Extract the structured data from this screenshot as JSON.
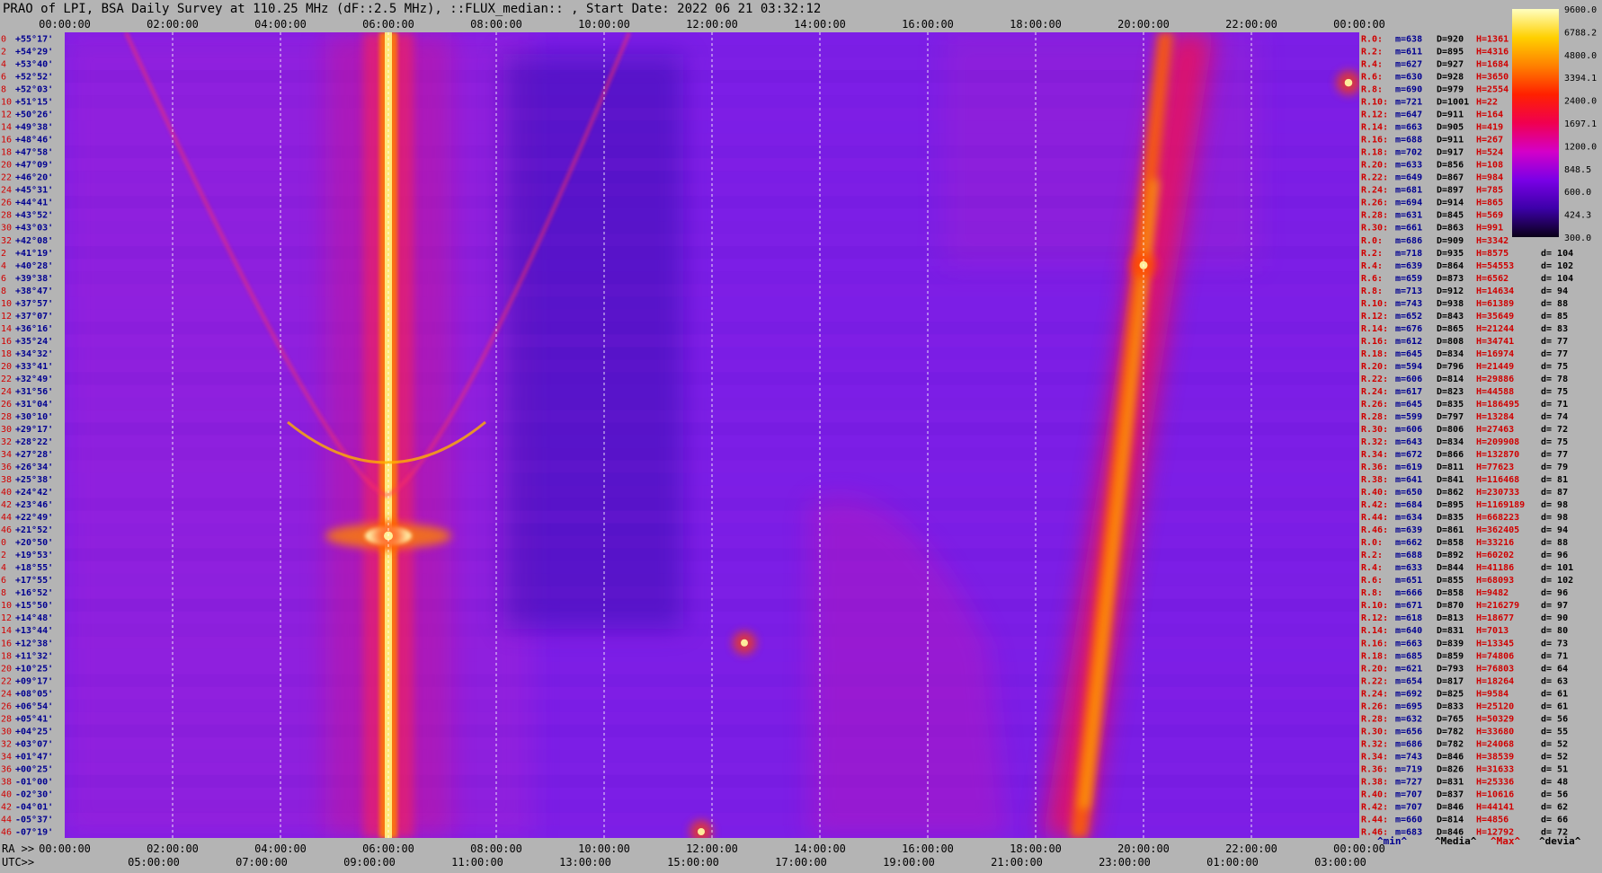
{
  "header": {
    "title": "PRAO of LPI, BSA Daily Survey at 110.25 MHz (dF::2.5 MHz), ::FLUX_median:: , Start Date: 2022 06 21 03:32:12"
  },
  "chart_data": {
    "type": "heatmap",
    "title": "PRAO of LPI, BSA Daily Survey at 110.25 MHz (dF::2.5 MHz), ::FLUX_median:: , Start Date: 2022 06 21 03:32:12",
    "x_top_ticks": [
      "00:00:00",
      "02:00:00",
      "04:00:00",
      "06:00:00",
      "08:00:00",
      "10:00:00",
      "12:00:00",
      "14:00:00",
      "16:00:00",
      "18:00:00",
      "20:00:00",
      "22:00:00",
      "00:00:00"
    ],
    "x_bottom_ra_prefix": "RA >>",
    "x_bottom_ra_ticks": [
      "00:00:00",
      "02:00:00",
      "04:00:00",
      "06:00:00",
      "08:00:00",
      "10:00:00",
      "12:00:00",
      "14:00:00",
      "16:00:00",
      "18:00:00",
      "20:00:00",
      "22:00:00",
      "00:00:00"
    ],
    "x_bottom_utc_prefix": "UTC>>",
    "x_bottom_utc_ticks": [
      "05:00:00",
      "07:00:00",
      "09:00:00",
      "11:00:00",
      "13:00:00",
      "15:00:00",
      "17:00:00",
      "19:00:00",
      "21:00:00",
      "23:00:00",
      "01:00:00",
      "03:00:00"
    ],
    "y_rows": [
      {
        "idx": "0",
        "dec": "+55°17'"
      },
      {
        "idx": "2",
        "dec": "+54°29'"
      },
      {
        "idx": "4",
        "dec": "+53°40'"
      },
      {
        "idx": "6",
        "dec": "+52°52'"
      },
      {
        "idx": "8",
        "dec": "+52°03'"
      },
      {
        "idx": "10",
        "dec": "+51°15'"
      },
      {
        "idx": "12",
        "dec": "+50°26'"
      },
      {
        "idx": "14",
        "dec": "+49°38'"
      },
      {
        "idx": "16",
        "dec": "+48°46'"
      },
      {
        "idx": "18",
        "dec": "+47°58'"
      },
      {
        "idx": "20",
        "dec": "+47°09'"
      },
      {
        "idx": "22",
        "dec": "+46°20'"
      },
      {
        "idx": "24",
        "dec": "+45°31'"
      },
      {
        "idx": "26",
        "dec": "+44°41'"
      },
      {
        "idx": "28",
        "dec": "+43°52'"
      },
      {
        "idx": "30",
        "dec": "+43°03'"
      },
      {
        "idx": "32",
        "dec": "+42°08'"
      },
      {
        "idx": "2",
        "dec": "+41°19'"
      },
      {
        "idx": "4",
        "dec": "+40°28'"
      },
      {
        "idx": "6",
        "dec": "+39°38'"
      },
      {
        "idx": "8",
        "dec": "+38°47'"
      },
      {
        "idx": "10",
        "dec": "+37°57'"
      },
      {
        "idx": "12",
        "dec": "+37°07'"
      },
      {
        "idx": "14",
        "dec": "+36°16'"
      },
      {
        "idx": "16",
        "dec": "+35°24'"
      },
      {
        "idx": "18",
        "dec": "+34°32'"
      },
      {
        "idx": "20",
        "dec": "+33°41'"
      },
      {
        "idx": "22",
        "dec": "+32°49'"
      },
      {
        "idx": "24",
        "dec": "+31°56'"
      },
      {
        "idx": "26",
        "dec": "+31°04'"
      },
      {
        "idx": "28",
        "dec": "+30°10'"
      },
      {
        "idx": "30",
        "dec": "+29°17'"
      },
      {
        "idx": "32",
        "dec": "+28°22'"
      },
      {
        "idx": "34",
        "dec": "+27°28'"
      },
      {
        "idx": "36",
        "dec": "+26°34'"
      },
      {
        "idx": "38",
        "dec": "+25°38'"
      },
      {
        "idx": "40",
        "dec": "+24°42'"
      },
      {
        "idx": "42",
        "dec": "+23°46'"
      },
      {
        "idx": "44",
        "dec": "+22°49'"
      },
      {
        "idx": "46",
        "dec": "+21°52'"
      },
      {
        "idx": "0",
        "dec": "+20°50'"
      },
      {
        "idx": "2",
        "dec": "+19°53'"
      },
      {
        "idx": "4",
        "dec": "+18°55'"
      },
      {
        "idx": "6",
        "dec": "+17°55'"
      },
      {
        "idx": "8",
        "dec": "+16°52'"
      },
      {
        "idx": "10",
        "dec": "+15°50'"
      },
      {
        "idx": "12",
        "dec": "+14°48'"
      },
      {
        "idx": "14",
        "dec": "+13°44'"
      },
      {
        "idx": "16",
        "dec": "+12°38'"
      },
      {
        "idx": "18",
        "dec": "+11°32'"
      },
      {
        "idx": "20",
        "dec": "+10°25'"
      },
      {
        "idx": "22",
        "dec": "+09°17'"
      },
      {
        "idx": "24",
        "dec": "+08°05'"
      },
      {
        "idx": "26",
        "dec": "+06°54'"
      },
      {
        "idx": "28",
        "dec": "+05°41'"
      },
      {
        "idx": "30",
        "dec": "+04°25'"
      },
      {
        "idx": "32",
        "dec": "+03°07'"
      },
      {
        "idx": "34",
        "dec": "+01°47'"
      },
      {
        "idx": "36",
        "dec": "+00°25'"
      },
      {
        "idx": "38",
        "dec": "-01°00'"
      },
      {
        "idx": "40",
        "dec": "-02°30'"
      },
      {
        "idx": "42",
        "dec": "-04°01'"
      },
      {
        "idx": "44",
        "dec": "-05°37'"
      },
      {
        "idx": "46",
        "dec": "-07°19'"
      }
    ],
    "stats": [
      {
        "r": "R.0:",
        "m": "m=638",
        "d": "D=920",
        "h": "H=1361",
        "dev": ""
      },
      {
        "r": "R.2:",
        "m": "m=611",
        "d": "D=895",
        "h": "H=4316",
        "dev": ""
      },
      {
        "r": "R.4:",
        "m": "m=627",
        "d": "D=927",
        "h": "H=1684",
        "dev": ""
      },
      {
        "r": "R.6:",
        "m": "m=630",
        "d": "D=928",
        "h": "H=3650",
        "dev": ""
      },
      {
        "r": "R.8:",
        "m": "m=690",
        "d": "D=979",
        "h": "H=2554",
        "dev": ""
      },
      {
        "r": "R.10:",
        "m": "m=721",
        "d": "D=1001",
        "h": "H=22",
        "dev": ""
      },
      {
        "r": "R.12:",
        "m": "m=647",
        "d": "D=911",
        "h": "H=164",
        "dev": ""
      },
      {
        "r": "R.14:",
        "m": "m=663",
        "d": "D=905",
        "h": "H=419",
        "dev": ""
      },
      {
        "r": "R.16:",
        "m": "m=688",
        "d": "D=911",
        "h": "H=267",
        "dev": ""
      },
      {
        "r": "R.18:",
        "m": "m=702",
        "d": "D=917",
        "h": "H=524",
        "dev": ""
      },
      {
        "r": "R.20:",
        "m": "m=633",
        "d": "D=856",
        "h": "H=108",
        "dev": ""
      },
      {
        "r": "R.22:",
        "m": "m=649",
        "d": "D=867",
        "h": "H=984",
        "dev": ""
      },
      {
        "r": "R.24:",
        "m": "m=681",
        "d": "D=897",
        "h": "H=785",
        "dev": ""
      },
      {
        "r": "R.26:",
        "m": "m=694",
        "d": "D=914",
        "h": "H=865",
        "dev": ""
      },
      {
        "r": "R.28:",
        "m": "m=631",
        "d": "D=845",
        "h": "H=569",
        "dev": ""
      },
      {
        "r": "R.30:",
        "m": "m=661",
        "d": "D=863",
        "h": "H=991",
        "dev": ""
      },
      {
        "r": "R.0:",
        "m": "m=686",
        "d": "D=909",
        "h": "H=3342",
        "dev": ""
      },
      {
        "r": "R.2:",
        "m": "m=718",
        "d": "D=935",
        "h": "H=8575",
        "dev": "d= 104"
      },
      {
        "r": "R.4:",
        "m": "m=639",
        "d": "D=864",
        "h": "H=54553",
        "dev": "d= 102"
      },
      {
        "r": "R.6:",
        "m": "m=659",
        "d": "D=873",
        "h": "H=6562",
        "dev": "d= 104"
      },
      {
        "r": "R.8:",
        "m": "m=713",
        "d": "D=912",
        "h": "H=14634",
        "dev": "d= 94"
      },
      {
        "r": "R.10:",
        "m": "m=743",
        "d": "D=938",
        "h": "H=61389",
        "dev": "d= 88"
      },
      {
        "r": "R.12:",
        "m": "m=652",
        "d": "D=843",
        "h": "H=35649",
        "dev": "d= 85"
      },
      {
        "r": "R.14:",
        "m": "m=676",
        "d": "D=865",
        "h": "H=21244",
        "dev": "d= 83"
      },
      {
        "r": "R.16:",
        "m": "m=612",
        "d": "D=808",
        "h": "H=34741",
        "dev": "d= 77"
      },
      {
        "r": "R.18:",
        "m": "m=645",
        "d": "D=834",
        "h": "H=16974",
        "dev": "d= 77"
      },
      {
        "r": "R.20:",
        "m": "m=594",
        "d": "D=796",
        "h": "H=21449",
        "dev": "d= 75"
      },
      {
        "r": "R.22:",
        "m": "m=606",
        "d": "D=814",
        "h": "H=29886",
        "dev": "d= 78"
      },
      {
        "r": "R.24:",
        "m": "m=617",
        "d": "D=823",
        "h": "H=44588",
        "dev": "d= 75"
      },
      {
        "r": "R.26:",
        "m": "m=645",
        "d": "D=835",
        "h": "H=186495",
        "dev": "d= 71"
      },
      {
        "r": "R.28:",
        "m": "m=599",
        "d": "D=797",
        "h": "H=13284",
        "dev": "d= 74"
      },
      {
        "r": "R.30:",
        "m": "m=606",
        "d": "D=806",
        "h": "H=27463",
        "dev": "d= 72"
      },
      {
        "r": "R.32:",
        "m": "m=643",
        "d": "D=834",
        "h": "H=209908",
        "dev": "d= 75"
      },
      {
        "r": "R.34:",
        "m": "m=672",
        "d": "D=866",
        "h": "H=132870",
        "dev": "d= 77"
      },
      {
        "r": "R.36:",
        "m": "m=619",
        "d": "D=811",
        "h": "H=77623",
        "dev": "d= 79"
      },
      {
        "r": "R.38:",
        "m": "m=641",
        "d": "D=841",
        "h": "H=116468",
        "dev": "d= 81"
      },
      {
        "r": "R.40:",
        "m": "m=650",
        "d": "D=862",
        "h": "H=230733",
        "dev": "d= 87"
      },
      {
        "r": "R.42:",
        "m": "m=684",
        "d": "D=895",
        "h": "H=1169189",
        "dev": "d= 98"
      },
      {
        "r": "R.44:",
        "m": "m=634",
        "d": "D=835",
        "h": "H=668223",
        "dev": "d= 98"
      },
      {
        "r": "R.46:",
        "m": "m=639",
        "d": "D=861",
        "h": "H=362405",
        "dev": "d= 94"
      },
      {
        "r": "R.0:",
        "m": "m=662",
        "d": "D=858",
        "h": "H=33216",
        "dev": "d= 88"
      },
      {
        "r": "R.2:",
        "m": "m=688",
        "d": "D=892",
        "h": "H=60202",
        "dev": "d= 96"
      },
      {
        "r": "R.4:",
        "m": "m=633",
        "d": "D=844",
        "h": "H=41186",
        "dev": "d= 101"
      },
      {
        "r": "R.6:",
        "m": "m=651",
        "d": "D=855",
        "h": "H=68093",
        "dev": "d= 102"
      },
      {
        "r": "R.8:",
        "m": "m=666",
        "d": "D=858",
        "h": "H=9482",
        "dev": "d= 96"
      },
      {
        "r": "R.10:",
        "m": "m=671",
        "d": "D=870",
        "h": "H=216279",
        "dev": "d= 97"
      },
      {
        "r": "R.12:",
        "m": "m=618",
        "d": "D=813",
        "h": "H=18677",
        "dev": "d= 90"
      },
      {
        "r": "R.14:",
        "m": "m=640",
        "d": "D=831",
        "h": "H=7013",
        "dev": "d= 80"
      },
      {
        "r": "R.16:",
        "m": "m=663",
        "d": "D=839",
        "h": "H=13345",
        "dev": "d= 73"
      },
      {
        "r": "R.18:",
        "m": "m=685",
        "d": "D=859",
        "h": "H=74806",
        "dev": "d= 71"
      },
      {
        "r": "R.20:",
        "m": "m=621",
        "d": "D=793",
        "h": "H=76803",
        "dev": "d= 64"
      },
      {
        "r": "R.22:",
        "m": "m=654",
        "d": "D=817",
        "h": "H=18264",
        "dev": "d= 63"
      },
      {
        "r": "R.24:",
        "m": "m=692",
        "d": "D=825",
        "h": "H=9584",
        "dev": "d= 61"
      },
      {
        "r": "R.26:",
        "m": "m=695",
        "d": "D=833",
        "h": "H=25120",
        "dev": "d= 61"
      },
      {
        "r": "R.28:",
        "m": "m=632",
        "d": "D=765",
        "h": "H=50329",
        "dev": "d= 56"
      },
      {
        "r": "R.30:",
        "m": "m=656",
        "d": "D=782",
        "h": "H=33680",
        "dev": "d= 55"
      },
      {
        "r": "R.32:",
        "m": "m=686",
        "d": "D=782",
        "h": "H=24068",
        "dev": "d= 52"
      },
      {
        "r": "R.34:",
        "m": "m=743",
        "d": "D=846",
        "h": "H=38539",
        "dev": "d= 52"
      },
      {
        "r": "R.36:",
        "m": "m=719",
        "d": "D=826",
        "h": "H=31633",
        "dev": "d= 51"
      },
      {
        "r": "R.38:",
        "m": "m=727",
        "d": "D=831",
        "h": "H=25336",
        "dev": "d= 48"
      },
      {
        "r": "R.40:",
        "m": "m=707",
        "d": "D=837",
        "h": "H=10616",
        "dev": "d= 56"
      },
      {
        "r": "R.42:",
        "m": "m=707",
        "d": "D=846",
        "h": "H=44141",
        "dev": "d= 62"
      },
      {
        "r": "R.44:",
        "m": "m=660",
        "d": "D=814",
        "h": "H=4856",
        "dev": "d= 66"
      },
      {
        "r": "R.46:",
        "m": "m=683",
        "d": "D=846",
        "h": "H=12792",
        "dev": "d= 72"
      }
    ],
    "stats_footer": {
      "min": "^min^",
      "media": "^Media^",
      "max": "^Max^",
      "devia": "^devia^"
    },
    "colorbar": {
      "labels": [
        "9600.0",
        "6788.2",
        "4800.0",
        "3394.1",
        "2400.0",
        "1697.1",
        "1200.0",
        "848.5",
        "600.0",
        "424.3",
        "300.0"
      ],
      "scale": "log",
      "range": [
        300,
        9600
      ],
      "colors": [
        "#0a0018",
        "#3c00a8",
        "#7a00e6",
        "#d400c8",
        "#f00050",
        "#ff2000",
        "#ff8000",
        "#ffd000",
        "#ffffc0"
      ]
    },
    "features": {
      "vertical_source_ra": "06:00:00",
      "sources": [
        {
          "ra_h": 6.0,
          "row": 39.5,
          "intensity": 1.0
        },
        {
          "ra_h": 20.0,
          "row": 18.0,
          "intensity": 0.9
        },
        {
          "ra_h": 12.6,
          "row": 48.0,
          "intensity": 0.8
        },
        {
          "ra_h": 11.8,
          "row": 63.0,
          "intensity": 0.8
        },
        {
          "ra_h": 23.8,
          "row": 3.5,
          "intensity": 0.85
        }
      ]
    },
    "palette": {
      "background": "#b4b4b4",
      "plot_base": "#7c1ee6",
      "text_blue": "#000090",
      "text_red": "#d00000",
      "text_dark": "#000000",
      "grid": "#ffffff"
    }
  }
}
